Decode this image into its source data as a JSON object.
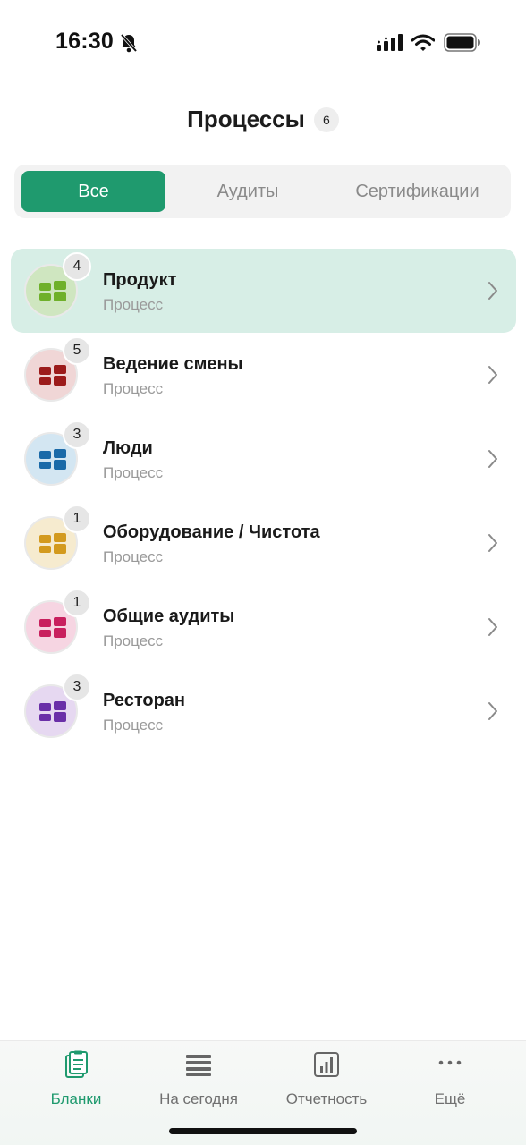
{
  "status_bar": {
    "time": "16:30",
    "icons": [
      "bell-off-icon",
      "signal-icon",
      "wifi-icon",
      "battery-icon"
    ]
  },
  "header": {
    "title": "Процессы",
    "count": "6"
  },
  "segments": {
    "all": "Все",
    "audits": "Аудиты",
    "certifications": "Сертификации",
    "selected": "all"
  },
  "processes": [
    {
      "title": "Продукт",
      "subtitle": "Процесс",
      "badge": "4",
      "color": "#6fb02a",
      "bg": "#cfe6c0",
      "active": true
    },
    {
      "title": "Ведение смены",
      "subtitle": "Процесс",
      "badge": "5",
      "color": "#9c1b1b",
      "bg": "#f0d6d6",
      "active": false
    },
    {
      "title": "Люди",
      "subtitle": "Процесс",
      "badge": "3",
      "color": "#1a6aa8",
      "bg": "#d3e6f2",
      "active": false
    },
    {
      "title": "Оборудование / Чистота",
      "subtitle": "Процесс",
      "badge": "1",
      "color": "#d39a1e",
      "bg": "#f6ebcf",
      "active": false
    },
    {
      "title": "Общие аудиты",
      "subtitle": "Процесс",
      "badge": "1",
      "color": "#c8205e",
      "bg": "#f6d5e2",
      "active": false
    },
    {
      "title": "Ресторан",
      "subtitle": "Процесс",
      "badge": "3",
      "color": "#6a2fa8",
      "bg": "#e6d8f1",
      "active": false
    }
  ],
  "nav": {
    "forms": "Бланки",
    "today": "На сегодня",
    "reports": "Отчетность",
    "more": "Ещё",
    "active": "forms",
    "active_color": "#1f9a6e"
  }
}
